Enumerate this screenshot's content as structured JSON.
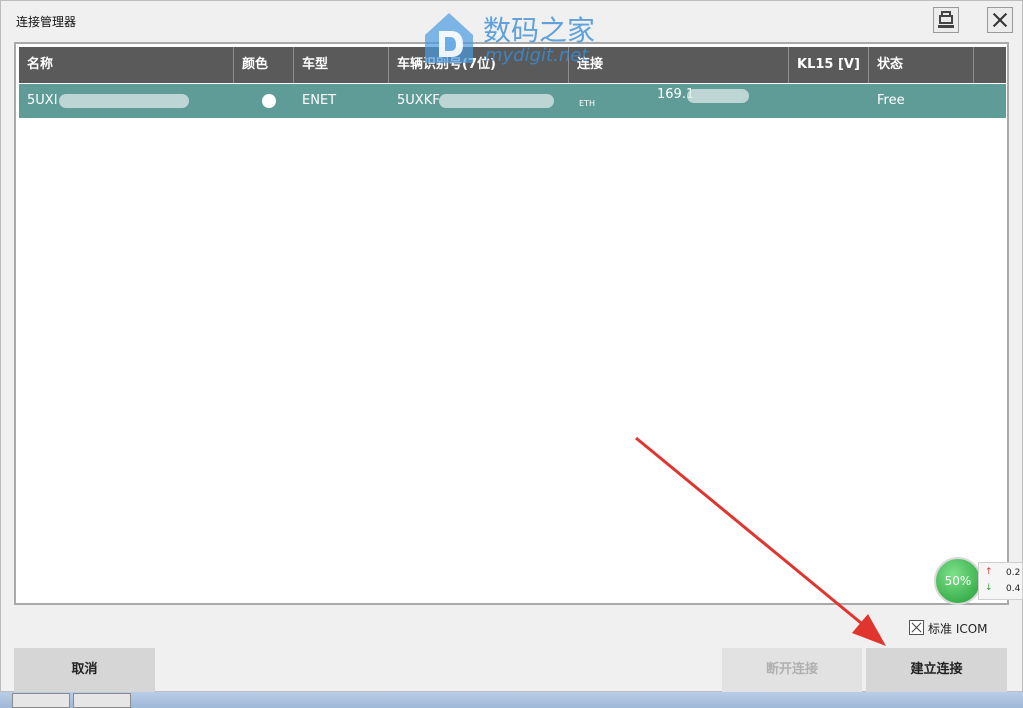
{
  "window": {
    "title": "连接管理器"
  },
  "table": {
    "columns": [
      "名称",
      "颜色",
      "车型",
      "车辆识别号(7位)",
      "连接",
      "KL15 [V]",
      "状态"
    ],
    "rows": [
      {
        "name": "5UXI",
        "vehicle_type": "ENET",
        "vin": "5UXKF",
        "conn_sub": "ETH",
        "conn": "169.1",
        "kl15": "",
        "status": "Free"
      }
    ]
  },
  "watermark": {
    "cn": "数码之家",
    "en": "mydigit.net"
  },
  "options": {
    "standard_icom_label": "标准 ICOM"
  },
  "buttons": {
    "cancel": "取消",
    "disconnect": "断开连接",
    "connect": "建立连接"
  },
  "speed_widget": {
    "percent": "50%",
    "up": "0.2",
    "down": "0.4"
  },
  "colors": {
    "header_bg": "#5a5a5a",
    "selected_row": "#5f9c98",
    "arrow": "#e0342e"
  }
}
